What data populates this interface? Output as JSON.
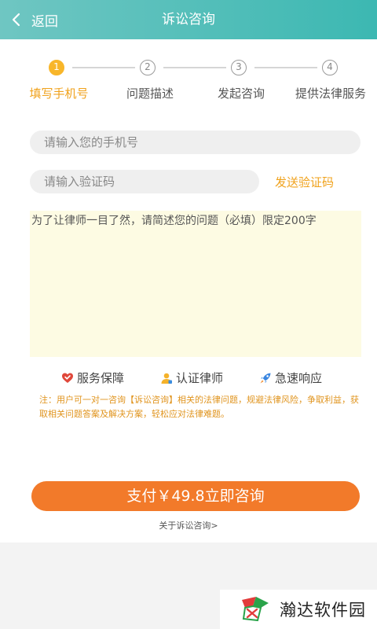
{
  "header": {
    "back_label": "返回",
    "title": "诉讼咨询"
  },
  "steps": [
    {
      "num": "1",
      "label": "填写手机号",
      "active": true
    },
    {
      "num": "2",
      "label": "问题描述",
      "active": false
    },
    {
      "num": "3",
      "label": "发起咨询",
      "active": false
    },
    {
      "num": "4",
      "label": "提供法律服务",
      "active": false
    }
  ],
  "form": {
    "phone_placeholder": "请输入您的手机号",
    "code_placeholder": "请输入验证码",
    "send_code_label": "发送验证码",
    "question_placeholder": "为了让律师一目了然，请简述您的问题（必填）限定200字"
  },
  "features": {
    "service": "服务保障",
    "certified": "认证律师",
    "fast": "急速响应"
  },
  "note": "注：用户可一对一咨询【诉讼咨询】相关的法律问题，规避法律风险，争取利益，获取相关问题答案及解决方案，轻松应对法律难题。",
  "pay_button": "支付￥49.8立即咨询",
  "about_link": "关于诉讼咨询>",
  "watermark_text": "瀚达软件园",
  "colors": {
    "header": "#3cb8b2",
    "accent": "#f0a21c",
    "pay": "#f27a2a"
  }
}
